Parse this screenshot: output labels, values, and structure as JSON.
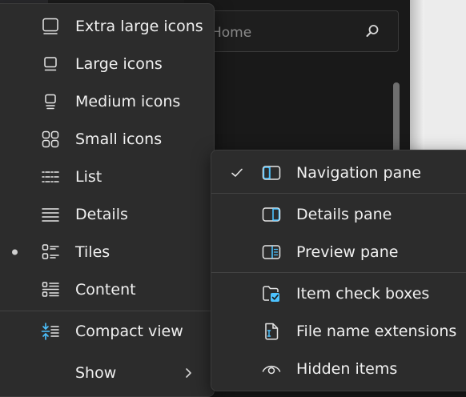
{
  "background": {
    "search_placeholder": "Home"
  },
  "view_menu": {
    "items": [
      {
        "label": "Extra large icons",
        "icon": "extra-large-icons-icon"
      },
      {
        "label": "Large icons",
        "icon": "large-icons-icon"
      },
      {
        "label": "Medium icons",
        "icon": "medium-icons-icon"
      },
      {
        "label": "Small icons",
        "icon": "small-icons-icon"
      },
      {
        "label": "List",
        "icon": "list-icon"
      },
      {
        "label": "Details",
        "icon": "details-icon"
      },
      {
        "label": "Tiles",
        "icon": "tiles-icon",
        "selected": true
      },
      {
        "label": "Content",
        "icon": "content-icon"
      }
    ],
    "compact_view": {
      "label": "Compact view",
      "icon": "compact-view-icon"
    },
    "show": {
      "label": "Show",
      "icon": "chevron-right-icon"
    }
  },
  "show_submenu": {
    "items": [
      {
        "label": "Navigation pane",
        "icon": "navigation-pane-icon",
        "checked": true
      },
      {
        "label": "Details pane",
        "icon": "details-pane-icon"
      },
      {
        "label": "Preview pane",
        "icon": "preview-pane-icon"
      },
      {
        "label": "Item check boxes",
        "icon": "item-check-boxes-icon"
      },
      {
        "label": "File name extensions",
        "icon": "file-name-extensions-icon"
      },
      {
        "label": "Hidden items",
        "icon": "hidden-items-icon"
      }
    ]
  },
  "colors": {
    "menu_bg": "#2c2c2c",
    "accent": "#4cc2ff",
    "text": "#f0f0f0"
  }
}
